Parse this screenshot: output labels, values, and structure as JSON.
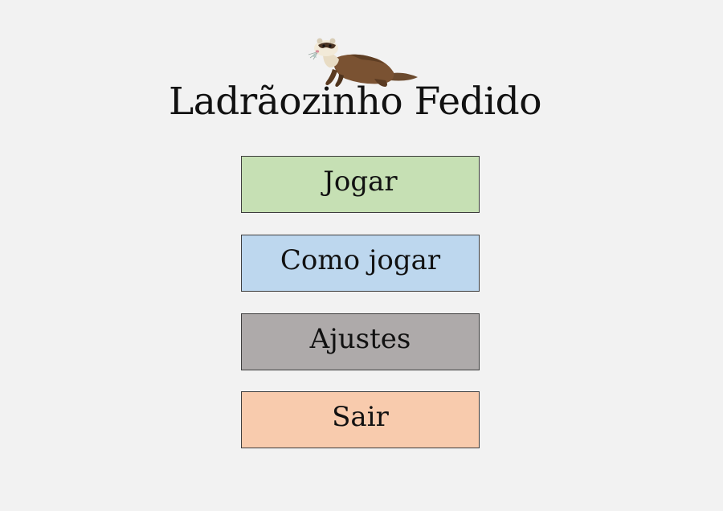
{
  "title": "Ladrãozinho Fedido",
  "logo": {
    "icon": "ferret-icon"
  },
  "menu": {
    "items": [
      {
        "label": "Jogar",
        "color": "#c6e0b4"
      },
      {
        "label": "Como jogar",
        "color": "#bdd7ee"
      },
      {
        "label": "Ajustes",
        "color": "#aeaaaa"
      },
      {
        "label": "Sair",
        "color": "#f8cbad"
      }
    ]
  }
}
